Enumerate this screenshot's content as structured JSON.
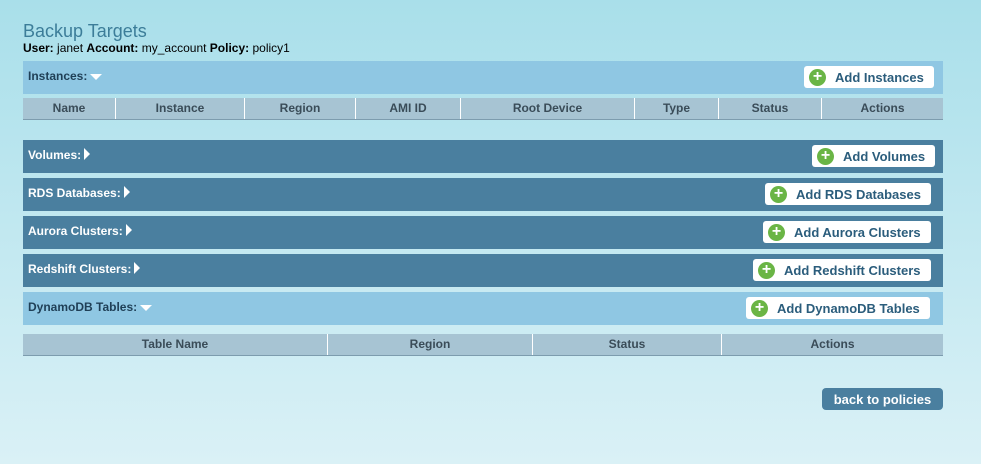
{
  "page": {
    "title": "Backup Targets",
    "user_label": "User:",
    "user": "janet",
    "account_label": "Account:",
    "account": "my_account",
    "policy_label": "Policy:",
    "policy": "policy1"
  },
  "sections": {
    "instances": {
      "label": "Instances:",
      "button": "Add Instances",
      "expanded": true
    },
    "volumes": {
      "label": "Volumes:",
      "button": "Add Volumes",
      "expanded": false
    },
    "rds": {
      "label": "RDS Databases:",
      "button": "Add RDS Databases",
      "expanded": false
    },
    "aurora": {
      "label": "Aurora Clusters:",
      "button": "Add Aurora Clusters",
      "expanded": false
    },
    "redshift": {
      "label": "Redshift Clusters:",
      "button": "Add Redshift Clusters",
      "expanded": false
    },
    "dynamodb": {
      "label": "DynamoDB Tables:",
      "button": "Add DynamoDB Tables",
      "expanded": true
    }
  },
  "instances_table": {
    "columns": [
      "Name",
      "Instance",
      "Region",
      "AMI ID",
      "Root Device",
      "Type",
      "Status",
      "Actions"
    ]
  },
  "dynamodb_table": {
    "columns": [
      "Table Name",
      "Region",
      "Status",
      "Actions"
    ]
  },
  "footer": {
    "back_button": "back to policies"
  },
  "colors": {
    "light_header": "#8fc7e3",
    "dark_header": "#4a7f9f",
    "add_icon": "#6ab545",
    "title": "#3c7d99"
  },
  "icons": {
    "add": "plus-circle-icon",
    "expanded": "caret-down-icon",
    "collapsed": "caret-right-icon"
  }
}
